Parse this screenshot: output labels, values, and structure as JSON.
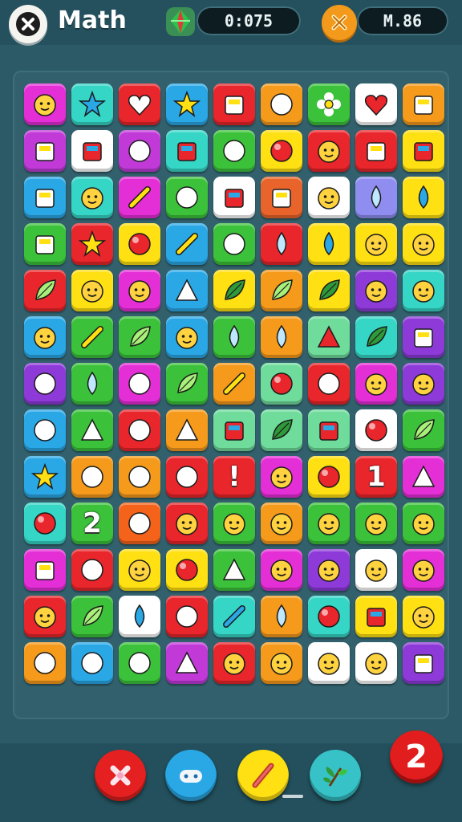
{
  "header": {
    "title": "Math",
    "timer": "0:075",
    "score": "M.86"
  },
  "board": {
    "rows": [
      [
        {
          "color": "#e52fd6",
          "icon": "face-hat-icon"
        },
        {
          "color": "#36d6c7",
          "icon": "star-plant-icon"
        },
        {
          "color": "#e8262b",
          "icon": "heart-icon"
        },
        {
          "color": "#2aa8e6",
          "icon": "star-icon"
        },
        {
          "color": "#e8262b",
          "icon": "capsule-icon"
        },
        {
          "color": "#f59a1b",
          "icon": "ball-icon"
        },
        {
          "color": "#3cc23a",
          "icon": "flower-icon"
        },
        {
          "color": "#ffffff",
          "icon": "gem-heart-icon"
        },
        {
          "color": "#f59a1b",
          "icon": "note-icon"
        }
      ],
      [
        {
          "color": "#c13ad8",
          "icon": "badge-icon"
        },
        {
          "color": "#ffffff",
          "icon": "box-icon"
        },
        {
          "color": "#c13ad8",
          "icon": "creature-icon"
        },
        {
          "color": "#36d6c7",
          "icon": "card-icon"
        },
        {
          "color": "#3cc23a",
          "icon": "turtle-icon"
        },
        {
          "color": "#ffe013",
          "icon": "bird-icon"
        },
        {
          "color": "#e8262b",
          "icon": "robot-face-icon"
        },
        {
          "color": "#e8262b",
          "icon": "screen-icon"
        },
        {
          "color": "#ffe013",
          "icon": "chat-icon"
        }
      ],
      [
        {
          "color": "#2aa8e6",
          "icon": "block-icon"
        },
        {
          "color": "#36d6c7",
          "icon": "chick-icon"
        },
        {
          "color": "#e52fd6",
          "icon": "pencil-icon"
        },
        {
          "color": "#3cc23a",
          "icon": "chess-icon"
        },
        {
          "color": "#ffffff",
          "icon": "jar-icon"
        },
        {
          "color": "#e8642b",
          "icon": "scroll-icon"
        },
        {
          "color": "#ffffff",
          "icon": "bird-face-icon"
        },
        {
          "color": "#8f8df0",
          "icon": "blob-icon"
        },
        {
          "color": "#ffe013",
          "icon": "balloon-icon"
        }
      ],
      [
        {
          "color": "#3cc23a",
          "icon": "tray-icon"
        },
        {
          "color": "#e8262b",
          "icon": "star-badge-icon"
        },
        {
          "color": "#ffe013",
          "icon": "rice-ball-icon"
        },
        {
          "color": "#2aa8e6",
          "icon": "meat-icon"
        },
        {
          "color": "#3cc23a",
          "icon": "pizza-icon"
        },
        {
          "color": "#e8262b",
          "icon": "plum-icon"
        },
        {
          "color": "#ffe013",
          "icon": "drop-icon"
        },
        {
          "color": "#ffe013",
          "icon": "pink-face-icon"
        },
        {
          "color": "#ffe013",
          "icon": "red-face-icon"
        }
      ],
      [
        {
          "color": "#e8262b",
          "icon": "palm-icon"
        },
        {
          "color": "#ffe013",
          "icon": "cup-face-icon"
        },
        {
          "color": "#e52fd6",
          "icon": "jar-face-icon"
        },
        {
          "color": "#2aa8e6",
          "icon": "cake-icon"
        },
        {
          "color": "#ffe013",
          "icon": "carrot-icon"
        },
        {
          "color": "#f59a1b",
          "icon": "tree-icon"
        },
        {
          "color": "#ffe013",
          "icon": "lotus-icon"
        },
        {
          "color": "#8e3ad8",
          "icon": "pear-face-icon"
        },
        {
          "color": "#36d6c7",
          "icon": "lion-icon"
        }
      ],
      [
        {
          "color": "#2aa8e6",
          "icon": "cat-icon"
        },
        {
          "color": "#3cc23a",
          "icon": "crayon-icon"
        },
        {
          "color": "#3cc23a",
          "icon": "feather-icon"
        },
        {
          "color": "#2aa8e6",
          "icon": "candy-icon"
        },
        {
          "color": "#3cc23a",
          "icon": "egg-icon"
        },
        {
          "color": "#f59a1b",
          "icon": "grape-icon"
        },
        {
          "color": "#6fdc9c",
          "icon": "watermelon-icon"
        },
        {
          "color": "#36d6c7",
          "icon": "leaf-icon"
        },
        {
          "color": "#8e3ad8",
          "icon": "toaster-icon"
        }
      ],
      [
        {
          "color": "#8e3ad8",
          "icon": "goblet-icon"
        },
        {
          "color": "#3cc23a",
          "icon": "egg-white-icon"
        },
        {
          "color": "#e52fd6",
          "icon": "marshmallow-icon"
        },
        {
          "color": "#3cc23a",
          "icon": "grass-icon"
        },
        {
          "color": "#f59a1b",
          "icon": "hotdog-icon"
        },
        {
          "color": "#6fdc9c",
          "icon": "turtle-small-icon"
        },
        {
          "color": "#e8262b",
          "icon": "pepper-icon"
        },
        {
          "color": "#e52fd6",
          "icon": "blue-face-icon"
        },
        {
          "color": "#8e3ad8",
          "icon": "moon-face-icon"
        }
      ],
      [
        {
          "color": "#2aa8e6",
          "icon": "orange-icon"
        },
        {
          "color": "#3cc23a",
          "icon": "pie-slice-icon"
        },
        {
          "color": "#e8262b",
          "icon": "apple-icon"
        },
        {
          "color": "#f59a1b",
          "icon": "shell-icon"
        },
        {
          "color": "#6fdc9c",
          "icon": "capsule-green-icon"
        },
        {
          "color": "#6fdc9c",
          "icon": "sprout-icon"
        },
        {
          "color": "#6fdc9c",
          "icon": "tube-icon"
        },
        {
          "color": "#ffffff",
          "icon": "spiral-icon"
        },
        {
          "color": "#3cc23a",
          "icon": "bouquet-icon"
        }
      ],
      [
        {
          "color": "#2aa8e6",
          "icon": "starfish-icon"
        },
        {
          "color": "#f59a1b",
          "icon": "pink-ball-icon"
        },
        {
          "color": "#f59a1b",
          "icon": "yellow-ball-icon"
        },
        {
          "color": "#e8262b",
          "icon": "bowl-icon"
        },
        {
          "color": "#e8262b",
          "icon": "exclaim-glyph",
          "glyph": "!"
        },
        {
          "color": "#e52fd6",
          "icon": "ghost-icon"
        },
        {
          "color": "#ffe013",
          "icon": "red-apple-icon"
        },
        {
          "color": "#e8262b",
          "icon": "one-glyph",
          "glyph": "1"
        },
        {
          "color": "#e52fd6",
          "icon": "cone-icon"
        }
      ],
      [
        {
          "color": "#36d6c7",
          "icon": "white-ball-icon"
        },
        {
          "color": "#3cc23a",
          "icon": "two-glyph",
          "glyph": "2"
        },
        {
          "color": "#f5631b",
          "icon": "pink-circle-icon"
        },
        {
          "color": "#e8262b",
          "icon": "green-face-icon"
        },
        {
          "color": "#3cc23a",
          "icon": "orange-face-icon"
        },
        {
          "color": "#f59a1b",
          "icon": "white-face-icon"
        },
        {
          "color": "#3cc23a",
          "icon": "bunny-icon"
        },
        {
          "color": "#3cc23a",
          "icon": "smile-icon"
        },
        {
          "color": "#3cc23a",
          "icon": "smile-white-icon"
        }
      ],
      [
        {
          "color": "#e52fd6",
          "icon": "battery-icon"
        },
        {
          "color": "#e8262b",
          "icon": "mouth-icon"
        },
        {
          "color": "#ffe013",
          "icon": "alien-icon"
        },
        {
          "color": "#ffe013",
          "icon": "helmet-icon"
        },
        {
          "color": "#3cc23a",
          "icon": "shell-white-icon"
        },
        {
          "color": "#e52fd6",
          "icon": "purple-face-icon"
        },
        {
          "color": "#8e3ad8",
          "icon": "candy-bar-icon"
        },
        {
          "color": "#ffffff",
          "icon": "yellow-face-icon"
        },
        {
          "color": "#e52fd6",
          "icon": "can-face-icon"
        }
      ],
      [
        {
          "color": "#e8262b",
          "icon": "mug-face-icon"
        },
        {
          "color": "#3cc23a",
          "icon": "branch-icon"
        },
        {
          "color": "#ffffff",
          "icon": "gumdrop-icon"
        },
        {
          "color": "#e8262b",
          "icon": "white-round-icon"
        },
        {
          "color": "#36d6c7",
          "icon": "pencil-yellow-icon"
        },
        {
          "color": "#f59a1b",
          "icon": "egg-red-icon"
        },
        {
          "color": "#36d6c7",
          "icon": "potion-icon"
        },
        {
          "color": "#ffe013",
          "icon": "phone-icon"
        },
        {
          "color": "#ffe013",
          "icon": "violet-face-icon"
        }
      ],
      [
        {
          "color": "#f59a1b",
          "icon": "strawberry-icon"
        },
        {
          "color": "#2aa8e6",
          "icon": "pink-bird-icon"
        },
        {
          "color": "#3cc23a",
          "icon": "blue-bird-icon"
        },
        {
          "color": "#c13ad8",
          "icon": "kite-icon"
        },
        {
          "color": "#e8262b",
          "icon": "sun-face-icon"
        },
        {
          "color": "#f59a1b",
          "icon": "peach-face-icon"
        },
        {
          "color": "#ffffff",
          "icon": "tomato-face-icon"
        },
        {
          "color": "#ffffff",
          "icon": "frog-face-icon"
        },
        {
          "color": "#8e3ad8",
          "icon": "lantern-icon"
        }
      ]
    ]
  },
  "powerups": [
    {
      "name": "cross-powerup-button",
      "color": "#e52020",
      "icon": "cross-icon"
    },
    {
      "name": "gamepad-powerup-button",
      "color": "#2aa8e6",
      "icon": "gamepad-icon"
    },
    {
      "name": "pencil-powerup-button",
      "color": "#ffe013",
      "icon": "pencil-icon"
    },
    {
      "name": "plant-powerup-button",
      "color": "#36c2c7",
      "icon": "plant-icon"
    }
  ],
  "moves_badge": "2"
}
